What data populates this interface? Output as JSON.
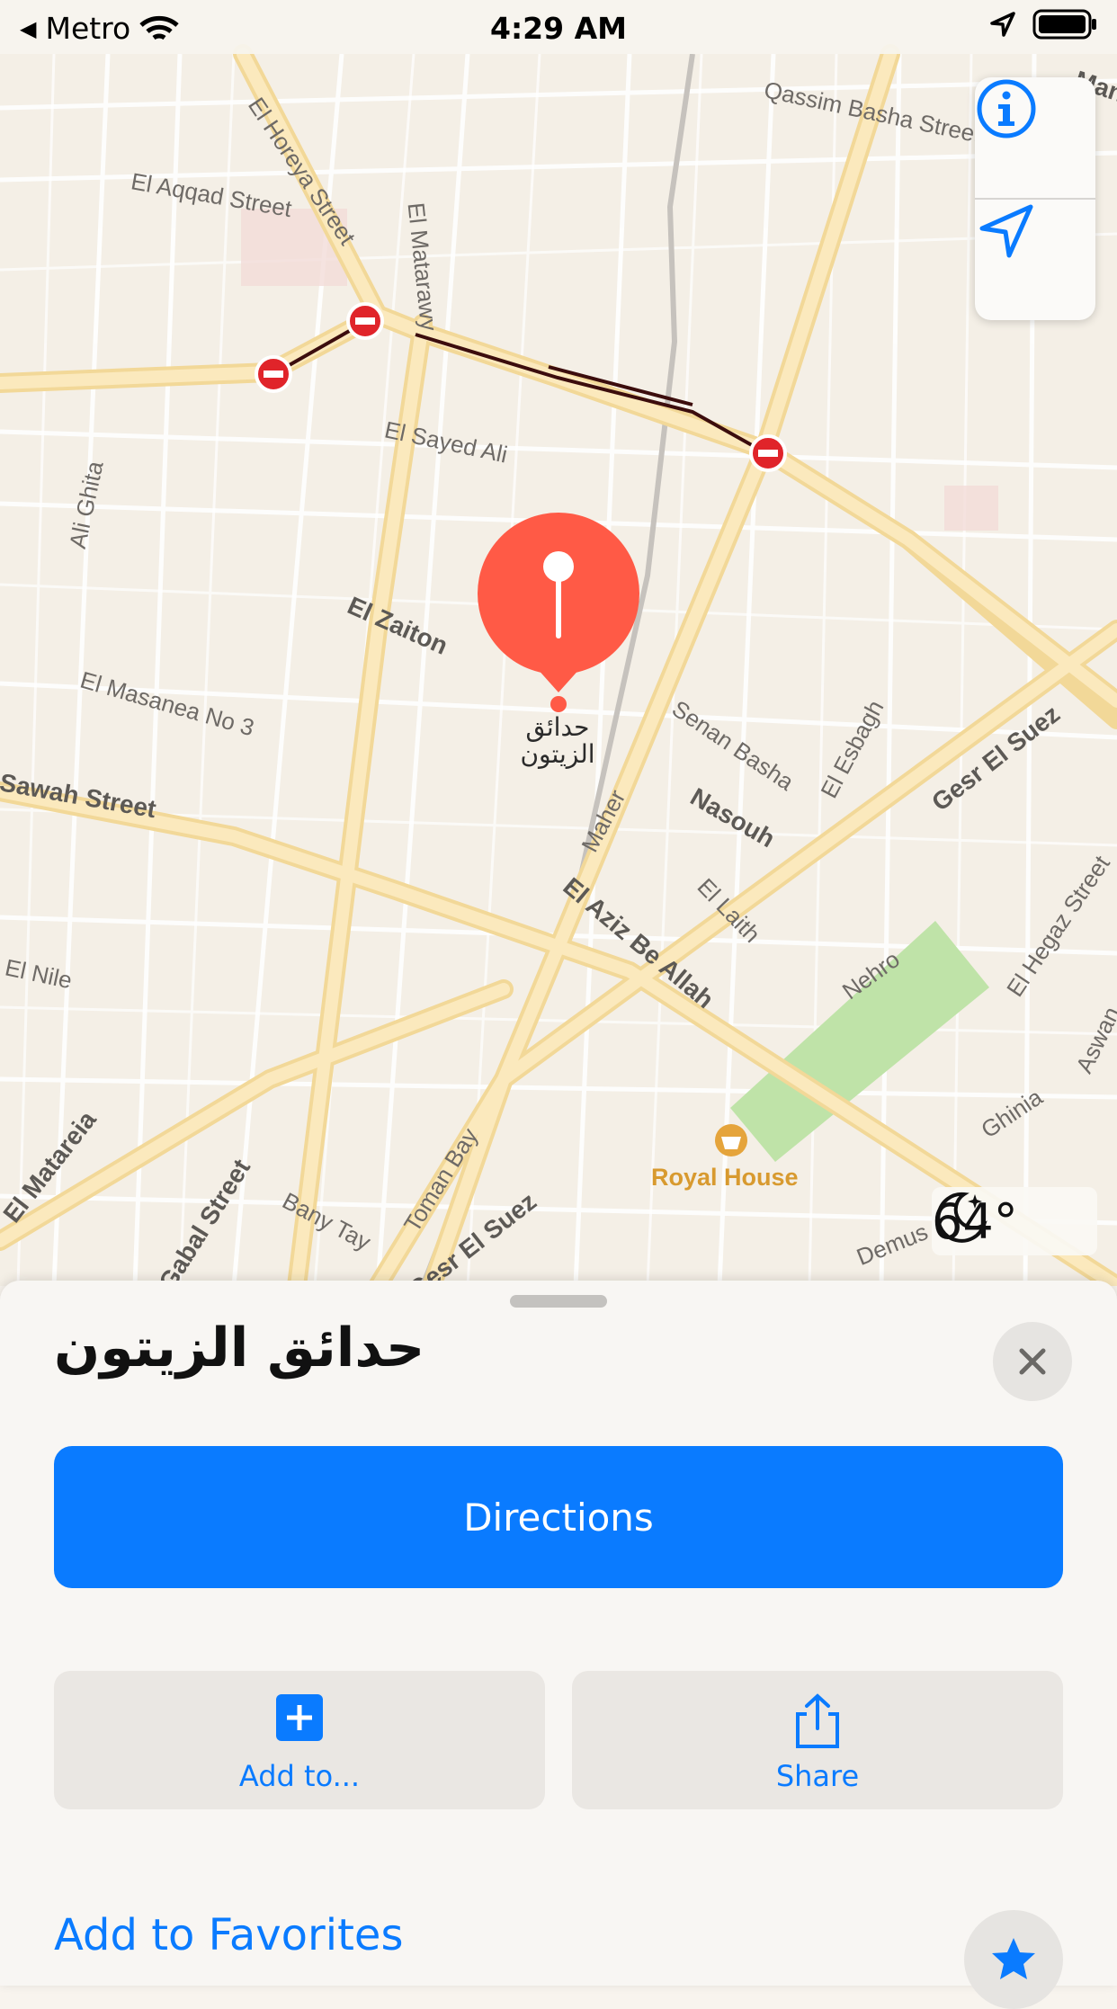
{
  "status_bar": {
    "carrier": "Metro",
    "time": "4:29 AM"
  },
  "map": {
    "street_labels": [
      "Qassim Basha Street",
      "El Horeya Street",
      "El Matarawy",
      "El Aqqad Street",
      "El Sayed Ali",
      "Ali Ghita",
      "El Zaiton",
      "El Masanea No 3",
      "Sawah Street",
      "Senan Basha",
      "El Esbagh",
      "Nasouh",
      "Gesr El Suez",
      "Maher",
      "El Aziz Be Allah",
      "El Laith",
      "Nehro",
      "El Hegaz Street",
      "El Nile",
      "El Matareia",
      "Gabal Street",
      "Bany Tay",
      "Toman Bay",
      "Gesr El Suez",
      "Ghinia",
      "Demus",
      "Aswan",
      "Man"
    ],
    "pin_label": "حدائق الزيتون",
    "poi": {
      "name": "Royal House",
      "icon": "shopping-basket-icon"
    },
    "weather": {
      "icon": "moon-icon",
      "temperature": "64°"
    },
    "controls": {
      "info_icon": "info-icon",
      "location_icon": "location-arrow-icon"
    }
  },
  "sheet": {
    "title": "حدائق الزيتون",
    "directions_label": "Directions",
    "actions": [
      {
        "label": "Add to...",
        "icon": "plus-square-icon"
      },
      {
        "label": "Share",
        "icon": "share-icon"
      }
    ],
    "favorites_label": "Add to Favorites"
  },
  "colors": {
    "accent": "#0a7bff",
    "pin": "#ff5a46",
    "park": "#bfe3a8",
    "road_major": "#fbe3a6",
    "closure": "#e0242a"
  }
}
